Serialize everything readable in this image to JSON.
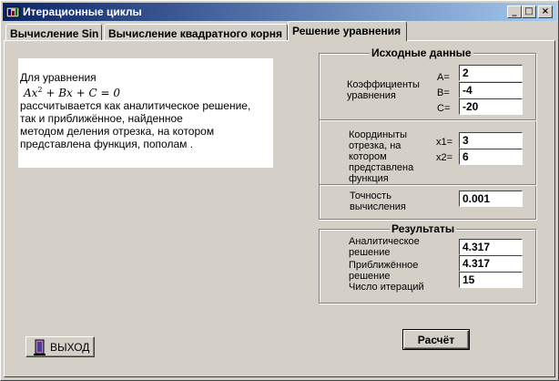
{
  "window": {
    "title": "Итерационные циклы"
  },
  "titlebar_buttons": {
    "minimize": "_",
    "maximize": "□",
    "close": "×"
  },
  "tabs": [
    {
      "label": "Вычисление Sin"
    },
    {
      "label": "Вычисление квадратного корня"
    },
    {
      "label": "Решение уравнения"
    }
  ],
  "description": {
    "line1": "Для уравнения",
    "formula": {
      "a": "Ax",
      "exp": "2",
      "rest": " + Bx + C = 0"
    },
    "line2": "рассчитывается как аналитическое решение,",
    "line3": "так и приближённое, найденное",
    "line4": "методом деления отрезка, на котором",
    "line5": "представлена функция, пополам ."
  },
  "input_group": {
    "title": "Исходные данные",
    "coef_label": "Коэффициенты уравнения",
    "coefs": [
      {
        "label": "A=",
        "value": "2"
      },
      {
        "label": "B=",
        "value": "-4"
      },
      {
        "label": "C=",
        "value": "-20"
      }
    ],
    "segment_label": "Координыты отрезка, на котором представлена функция",
    "segment": [
      {
        "label": "x1=",
        "value": "3"
      },
      {
        "label": "x2=",
        "value": "6"
      }
    ],
    "precision_label": "Точность вычисления",
    "precision_value": "0.001"
  },
  "results_group": {
    "title": "Результаты",
    "analytic_label": "Аналитическое решение",
    "analytic_value": "4.317",
    "approx_label": "Приближённое решение",
    "approx_value": "4.317",
    "iter_label": "Число итераций",
    "iter_value": "15"
  },
  "buttons": {
    "calc": "Расчёт",
    "exit": "ВЫХОД"
  }
}
